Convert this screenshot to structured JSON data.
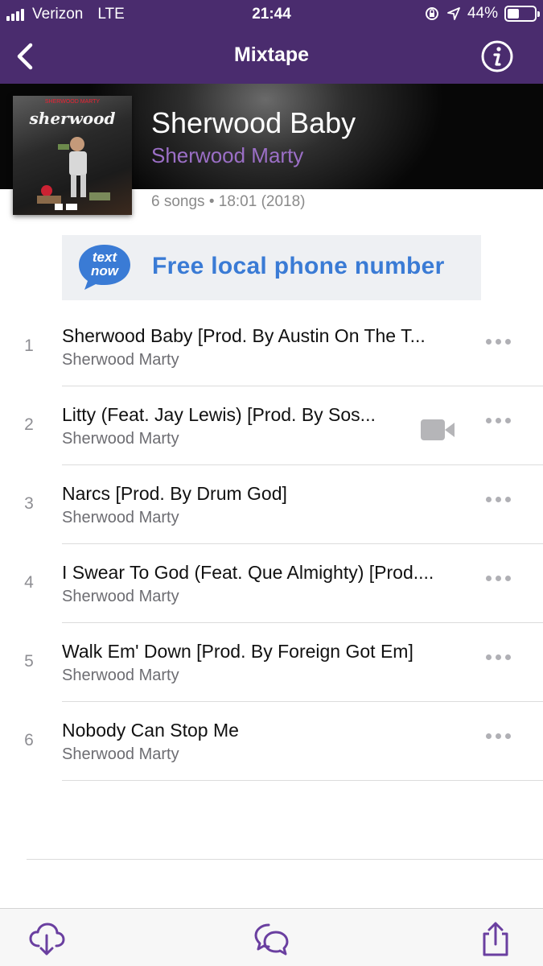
{
  "status": {
    "carrier": "Verizon",
    "network": "LTE",
    "time": "21:44",
    "battery": "44%",
    "battery_level": 0.44
  },
  "nav": {
    "title": "Mixtape",
    "back_icon": "chevron-left-icon",
    "info_icon": "info-icon"
  },
  "album": {
    "cover_title": "sherwood",
    "cover_sub": "SHERWOOD MARTY",
    "title": "Sherwood Baby",
    "artist": "Sherwood Marty",
    "meta": "6 songs • 18:01 (2018)"
  },
  "ad": {
    "logo_text": "text now",
    "text": "Free local phone number"
  },
  "tracks": [
    {
      "num": "1",
      "title": "Sherwood Baby [Prod. By Austin On The T...",
      "artist": "Sherwood Marty"
    },
    {
      "num": "2",
      "title": "Litty (Feat. Jay Lewis) [Prod. By Sos...",
      "artist": "Sherwood Marty",
      "has_video": true
    },
    {
      "num": "3",
      "title": "Narcs [Prod. By Drum God]",
      "artist": "Sherwood Marty"
    },
    {
      "num": "4",
      "title": "I Swear To God (Feat. Que Almighty) [Prod....",
      "artist": "Sherwood Marty"
    },
    {
      "num": "5",
      "title": "Walk Em' Down [Prod. By Foreign Got Em]",
      "artist": "Sherwood Marty"
    },
    {
      "num": "6",
      "title": "Nobody Can Stop Me",
      "artist": "Sherwood Marty"
    }
  ],
  "tabbar": {
    "icons": [
      "cloud-download-icon",
      "comments-icon",
      "share-icon"
    ]
  },
  "colors": {
    "header": "#4a2c6e",
    "accent": "#9b6fc6",
    "icon": "#6a3fa0"
  }
}
